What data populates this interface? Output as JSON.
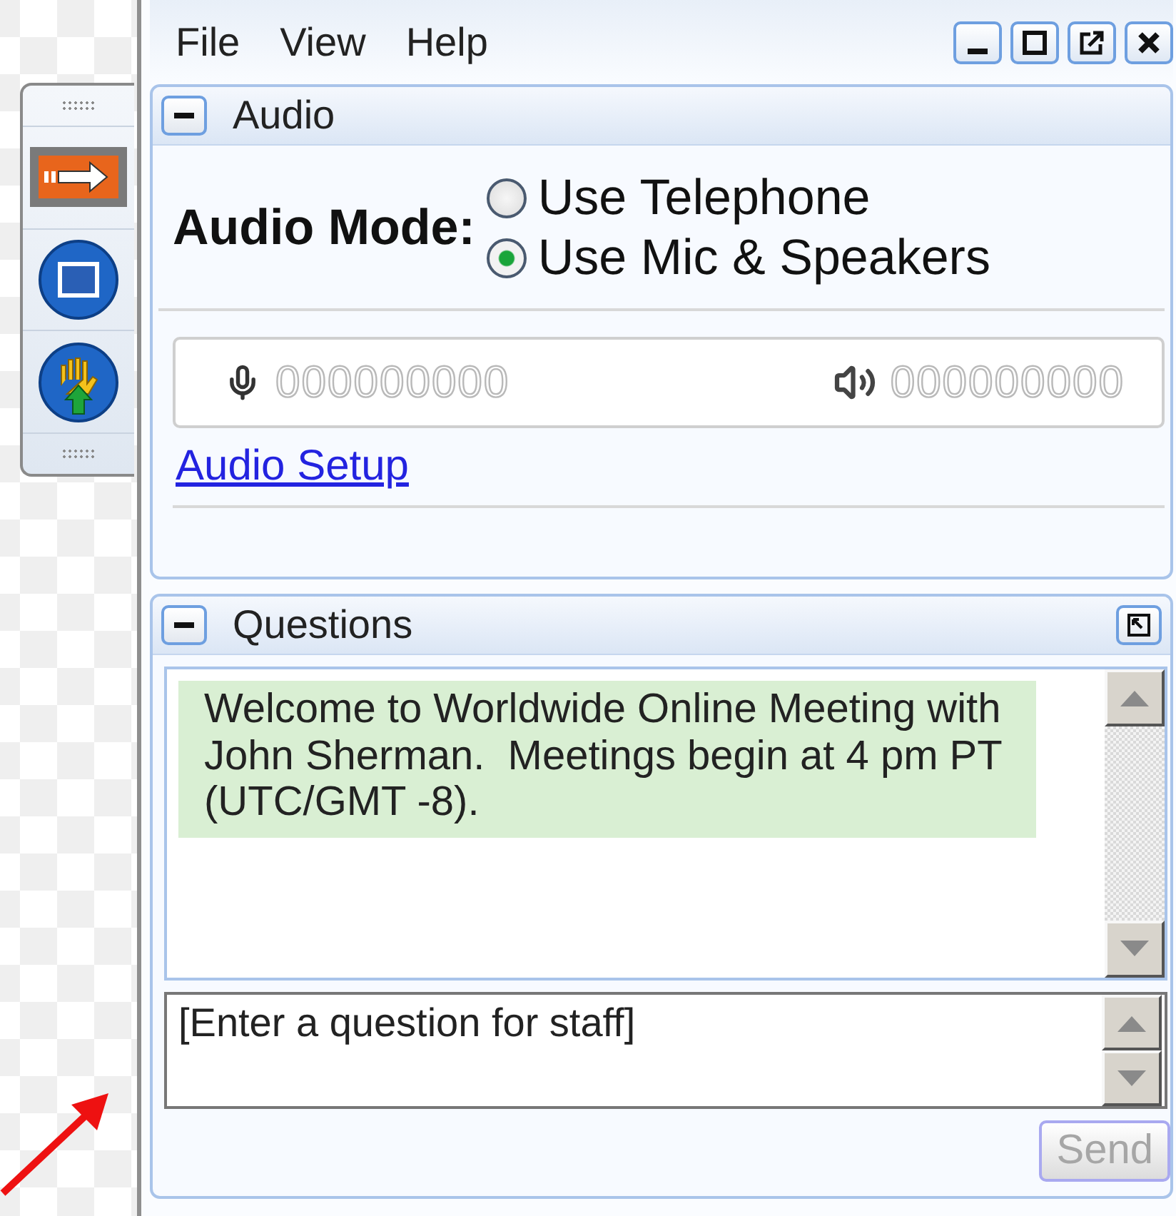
{
  "menu": [
    {
      "label": "File"
    },
    {
      "label": "View"
    },
    {
      "label": "Help"
    }
  ],
  "window_controls": [
    {
      "kind": "minimize"
    },
    {
      "kind": "maximize"
    },
    {
      "kind": "popout"
    },
    {
      "kind": "close"
    }
  ],
  "toolbar": {
    "items": [
      {
        "kind": "arrow",
        "selected": true
      },
      {
        "kind": "window",
        "selected": false
      },
      {
        "kind": "hand",
        "selected": false
      }
    ]
  },
  "audio": {
    "title": "Audio",
    "expanded": true,
    "mode_label": "Audio Mode:",
    "options": [
      {
        "label": "Use Telephone",
        "selected": false
      },
      {
        "label": "Use Mic & Speakers",
        "selected": true
      }
    ],
    "mic_meter": "000000000",
    "speaker_meter": "000000000",
    "setup_link": "Audio Setup"
  },
  "questions": {
    "title": "Questions",
    "expanded": true,
    "messages": [
      {
        "text": "Welcome to Worldwide Online Meeting with John Sherman.  Meetings begin at 4 pm PT (UTC/GMT -8)."
      }
    ],
    "input": {
      "placeholder": "[Enter a question for staff]"
    },
    "send": {
      "label": "Send",
      "disabled": true
    }
  }
}
